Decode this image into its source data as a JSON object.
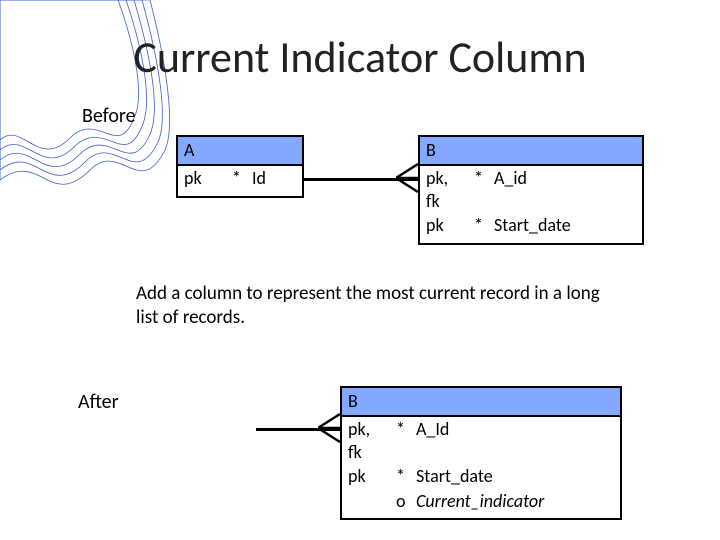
{
  "title": "Current Indicator Column",
  "labels": {
    "before": "Before",
    "after": "After"
  },
  "description": "Add a column to represent the most current record in a long list of records.",
  "entities": {
    "A": {
      "name": "A",
      "rows": [
        {
          "key": "pk",
          "mark": "*",
          "name": "Id"
        }
      ]
    },
    "B_before": {
      "name": "B",
      "rows": [
        {
          "key": "pk, fk",
          "mark": "*",
          "name": "A_id"
        },
        {
          "key": "pk",
          "mark": "*",
          "name": "Start_date"
        }
      ]
    },
    "B_after": {
      "name": "B",
      "rows": [
        {
          "key": "pk, fk",
          "mark": "*",
          "name": "A_Id"
        },
        {
          "key": "pk",
          "mark": "*",
          "name": "Start_date"
        },
        {
          "key": "",
          "mark": "o",
          "name": "Current_indicator",
          "italic": true
        }
      ]
    }
  }
}
